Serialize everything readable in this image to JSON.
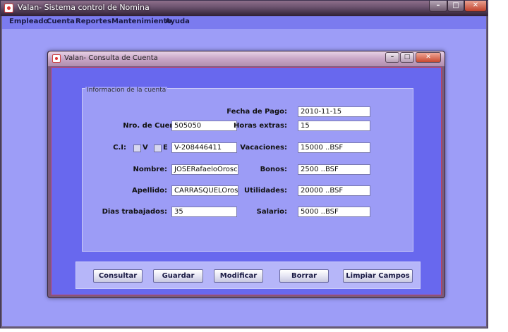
{
  "outer_window": {
    "title": "Valan- Sistema control de Nomina",
    "controls": {
      "minimize": "–",
      "maximize": "□",
      "close": "✕"
    }
  },
  "menu": {
    "items": [
      "Empleado",
      "Cuenta",
      "Reportes",
      "Mantenimiento",
      "Ayuda"
    ]
  },
  "dialog": {
    "title": "Valan- Consulta de Cuenta",
    "controls": {
      "minimize": "–",
      "maximize": "□",
      "close": "✕"
    },
    "panel_title": "Informacion de la cuenta",
    "labels": {
      "fecha_pago": "Fecha de Pago:",
      "nro_cuenta": "Nro. de Cuenta:",
      "horas_extras": "Horas extras:",
      "ci": "C.I:",
      "ci_v": "V",
      "ci_e": "E",
      "vacaciones": "Vacaciones:",
      "nombre": "Nombre:",
      "bonos": "Bonos:",
      "apellido": "Apellido:",
      "utilidades": "Utilidades:",
      "dias_trabajados": "Dias trabajados:",
      "salario": "Salario:"
    },
    "values": {
      "fecha_pago": "2010-11-15",
      "nro_cuenta": "505050",
      "horas_extras": "15",
      "ci": "V-208446411",
      "vacaciones": "15000 ..BSF",
      "nombre": "JOSERafaeloOrosc",
      "bonos": "2500  ..BSF",
      "apellido": "CARRASQUELOrosc",
      "utilidades": "20000 ..BSF",
      "dias_trabajados": "35",
      "salario": "5000 ..BSF"
    },
    "checkboxes": {
      "ci_v_checked": false,
      "ci_e_checked": false
    },
    "buttons": [
      "Consultar",
      "Guardar",
      "Modificar",
      "Borrar",
      "Limpiar Campos"
    ]
  }
}
